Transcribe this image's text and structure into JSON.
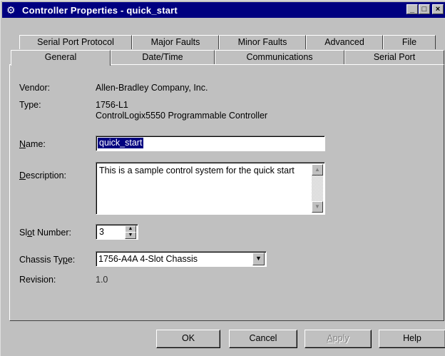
{
  "window": {
    "title": "Controller Properties - quick_start",
    "icon": "controller-icon",
    "controls": {
      "minimize": "_",
      "maximize": "□",
      "close": "×"
    }
  },
  "tabs": {
    "back_row": [
      "Serial Port Protocol",
      "Major Faults",
      "Minor Faults",
      "Advanced",
      "File"
    ],
    "front_row": [
      "General",
      "Date/Time",
      "Communications",
      "Serial Port"
    ],
    "active": "General"
  },
  "general": {
    "vendor_label": "Vendor:",
    "vendor_value": "Allen-Bradley Company, Inc.",
    "type_label": "Type:",
    "type_value_line1": "1756-L1",
    "type_value_line2": "ControlLogix5550 Programmable Controller",
    "name_label_prefix": "",
    "name_label_key": "N",
    "name_label_rest": "ame:",
    "name_value": "quick_start",
    "description_label_key": "D",
    "description_label_rest": "escription:",
    "description_value": "This is a sample control system for the quick start",
    "slot_label_pre": "Sl",
    "slot_label_key": "o",
    "slot_label_rest": "t Number:",
    "slot_value": "3",
    "chassis_label_pre": "Chassis Ty",
    "chassis_label_key": "p",
    "chassis_label_rest": "e:",
    "chassis_value": "1756-A4A 4-Slot Chassis",
    "revision_label": "Revision:",
    "revision_value": "1.0"
  },
  "buttons": {
    "ok": "OK",
    "cancel": "Cancel",
    "apply_key": "A",
    "apply_rest": "pply",
    "help": "Help"
  }
}
